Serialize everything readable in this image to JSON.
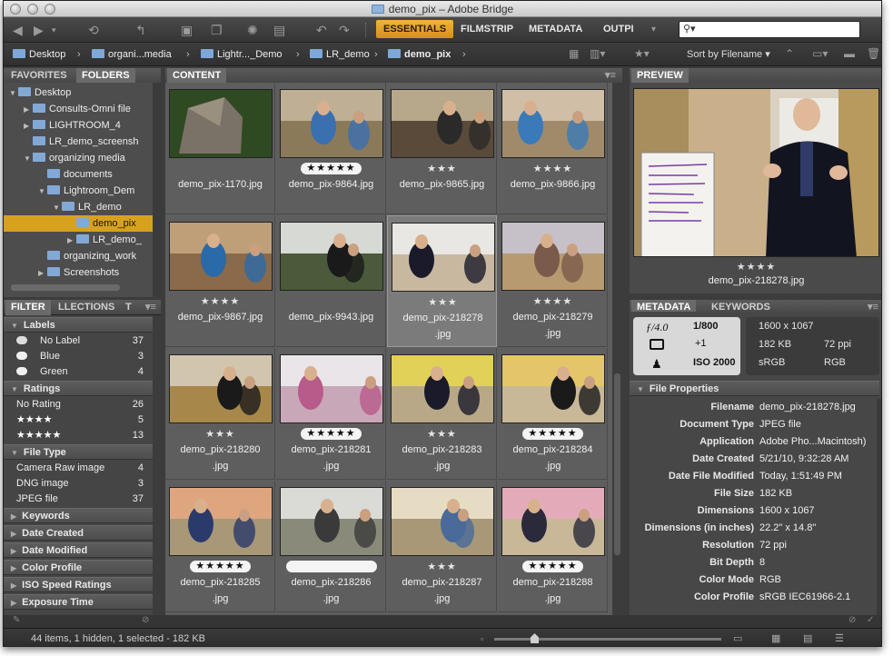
{
  "window": {
    "title": "demo_pix – Adobe Bridge"
  },
  "workspaces": [
    "ESSENTIALS",
    "FILMSTRIP",
    "METADATA",
    "OUTPI"
  ],
  "search": {
    "placeholder": ""
  },
  "path": [
    "Desktop",
    "organi...media",
    "Lightr..._Demo",
    "LR_demo",
    "demo_pix"
  ],
  "sort": {
    "label": "Sort by Filename"
  },
  "left_tabs": {
    "favorites": "FAVORITES",
    "folders": "FOLDERS"
  },
  "tree": [
    {
      "label": "Desktop"
    },
    {
      "label": "Consults-Omni file"
    },
    {
      "label": "LIGHTROOM_4"
    },
    {
      "label": "LR_demo_screensh"
    },
    {
      "label": "organizing media"
    },
    {
      "label": "documents"
    },
    {
      "label": "Lightroom_Dem"
    },
    {
      "label": "LR_demo"
    },
    {
      "label": "demo_pix"
    },
    {
      "label": "LR_demo_"
    },
    {
      "label": "organizing_work"
    },
    {
      "label": "Screenshots"
    }
  ],
  "filter_tabs": {
    "filter": "FILTER",
    "collections": "LLECTIONS",
    "export": "T"
  },
  "filter": {
    "labels_title": "Labels",
    "labels": [
      {
        "label": "No Label",
        "count": "37"
      },
      {
        "label": "Blue",
        "count": "3"
      },
      {
        "label": "Green",
        "count": "4"
      }
    ],
    "ratings_title": "Ratings",
    "ratings": [
      {
        "label": "No Rating",
        "count": "26"
      },
      {
        "label": "★★★★",
        "count": "5"
      },
      {
        "label": "★★★★★",
        "count": "13"
      }
    ],
    "filetype_title": "File Type",
    "filetypes": [
      {
        "label": "Camera Raw image",
        "count": "4"
      },
      {
        "label": "DNG image",
        "count": "3"
      },
      {
        "label": "JPEG file",
        "count": "37"
      }
    ],
    "collapsed": [
      "Keywords",
      "Date Created",
      "Date Modified",
      "Color Profile",
      "ISO Speed Ratings",
      "Exposure Time"
    ]
  },
  "content_tab": "CONTENT",
  "thumbnails": [
    {
      "line1": "demo_pix-1170.jpg",
      "line2": "",
      "rating": "",
      "pill": false
    },
    {
      "line1": "demo_pix-9864.jpg",
      "line2": "",
      "rating": "★★★★★",
      "pill": true
    },
    {
      "line1": "demo_pix-9865.jpg",
      "line2": "",
      "rating": "★★★",
      "pill": false
    },
    {
      "line1": "demo_pix-9866.jpg",
      "line2": "",
      "rating": "★★★★",
      "pill": false
    },
    {
      "line1": "demo_pix-9867.jpg",
      "line2": "",
      "rating": "★★★★",
      "pill": false
    },
    {
      "line1": "demo_pix-9943.jpg",
      "line2": "",
      "rating": "",
      "pill": false
    },
    {
      "line1": "demo_pix-218278",
      "line2": ".jpg",
      "rating": "★★★",
      "pill": false
    },
    {
      "line1": "demo_pix-218279",
      "line2": ".jpg",
      "rating": "★★★★",
      "pill": false
    },
    {
      "line1": "demo_pix-218280",
      "line2": ".jpg",
      "rating": "★★★",
      "pill": false
    },
    {
      "line1": "demo_pix-218281",
      "line2": ".jpg",
      "rating": "★★★★★",
      "pill": true
    },
    {
      "line1": "demo_pix-218283",
      "line2": ".jpg",
      "rating": "★★★",
      "pill": false
    },
    {
      "line1": "demo_pix-218284",
      "line2": ".jpg",
      "rating": "★★★★★",
      "pill": true
    },
    {
      "line1": "demo_pix-218285",
      "line2": ".jpg",
      "rating": "★★★★★",
      "pill": true
    },
    {
      "line1": "demo_pix-218286",
      "line2": ".jpg",
      "rating": "",
      "pill": true
    },
    {
      "line1": "demo_pix-218287",
      "line2": ".jpg",
      "rating": "★★★",
      "pill": false
    },
    {
      "line1": "demo_pix-218288",
      "line2": ".jpg",
      "rating": "★★★★★",
      "pill": true
    }
  ],
  "preview": {
    "tab": "PREVIEW",
    "rating": "★★★★",
    "filename": "demo_pix-218278.jpg"
  },
  "meta_tabs": {
    "metadata": "METADATA",
    "keywords": "KEYWORDS"
  },
  "camera": {
    "aperture": "ƒ/4.0",
    "shutter": "1/800",
    "exposure_comp": "+1",
    "iso": "2000",
    "dimensions": "1600 x 1067",
    "size": "182 KB",
    "ppi": "72 ppi",
    "profile": "sRGB",
    "mode": "RGB"
  },
  "file_properties": {
    "title": "File Properties",
    "rows": [
      {
        "k": "Filename",
        "v": "demo_pix-218278.jpg"
      },
      {
        "k": "Document Type",
        "v": "JPEG file"
      },
      {
        "k": "Application",
        "v": "Adobe Pho...Macintosh)"
      },
      {
        "k": "Date Created",
        "v": "5/21/10, 9:32:28 AM"
      },
      {
        "k": "Date File Modified",
        "v": "Today, 1:51:49 PM"
      },
      {
        "k": "File Size",
        "v": "182 KB"
      },
      {
        "k": "Dimensions",
        "v": "1600 x 1067"
      },
      {
        "k": "Dimensions (in inches)",
        "v": "22.2\" x 14.8\""
      },
      {
        "k": "Resolution",
        "v": "72 ppi"
      },
      {
        "k": "Bit Depth",
        "v": "8"
      },
      {
        "k": "Color Mode",
        "v": "RGB"
      },
      {
        "k": "Color Profile",
        "v": "sRGB IEC61966-2.1"
      }
    ]
  },
  "status": {
    "text": "44 items, 1 hidden, 1 selected - 182 KB"
  },
  "colors": {
    "accent": "#d6a21e",
    "panel": "#4d4d4d",
    "content_bg": "#5e5e5e"
  }
}
